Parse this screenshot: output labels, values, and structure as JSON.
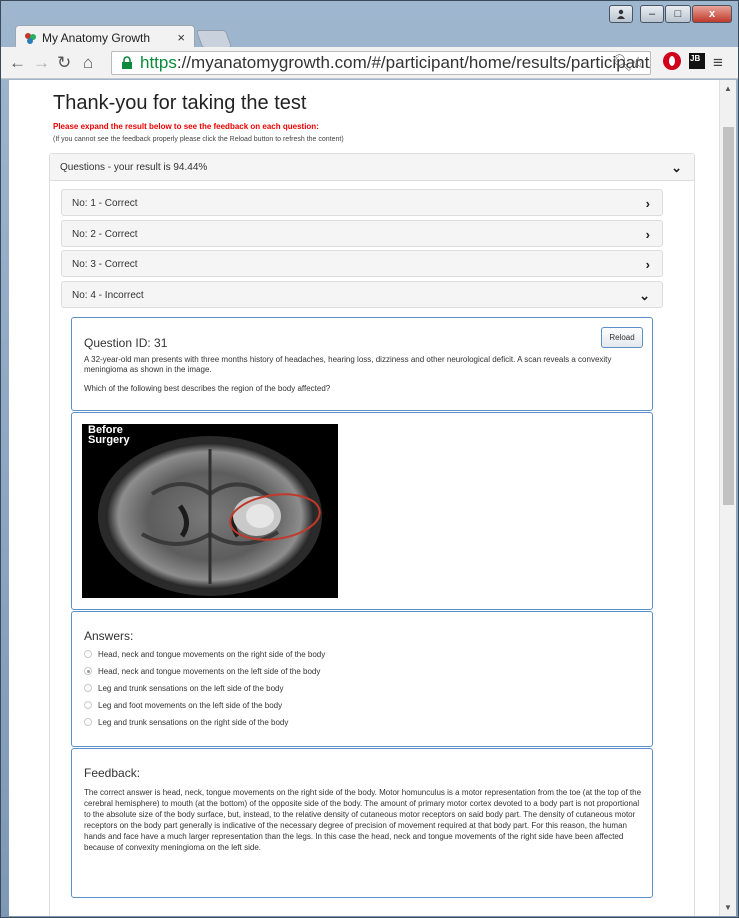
{
  "browser": {
    "tab_title": "My Anatomy Growth",
    "tab_close": "×",
    "url_scheme": "https",
    "url_rest": "://myanatomygrowth.com/#/participant/home/results/participantAs",
    "window_controls": [
      "–",
      "□",
      "x"
    ],
    "jb_label": "JB"
  },
  "page": {
    "heading": "Thank-you for taking the test",
    "warning": "Please expand the result below to see the feedback on each question:",
    "hint": "(If you cannot see the feedback properly please click the Reload button to refresh the content)"
  },
  "result": {
    "summary": "Questions - your result is 94.44%",
    "items": [
      {
        "label": "No: 1 - Correct"
      },
      {
        "label": "No: 2 - Correct"
      },
      {
        "label": "No: 3 - Correct"
      },
      {
        "label": "No: 4 - Incorrect"
      }
    ]
  },
  "question": {
    "id_label": "Question ID: 31",
    "reload_label": "Reload",
    "stem": "A 32-year-old man presents with three months history of headaches, hearing loss, dizziness and other neurological deficit. A scan reveals a convexity meningioma as shown in the image.",
    "prompt": "Which of the following best describes the region of the body affected?",
    "image_caption": "Before\nSurgery"
  },
  "answers": {
    "title": "Answers:",
    "options": [
      {
        "text": "Head, neck and tongue movements on the right side of the body",
        "selected": false
      },
      {
        "text": "Head, neck and tongue movements on the left side of the body",
        "selected": true
      },
      {
        "text": "Leg and trunk sensations on the left side of the body",
        "selected": false
      },
      {
        "text": "Leg and foot movements on the left side of the body",
        "selected": false
      },
      {
        "text": "Leg and trunk sensations on the right side of the body",
        "selected": false
      }
    ]
  },
  "feedback": {
    "title": "Feedback:",
    "text": "The correct answer is head, neck, tongue movements on the right side of the body. Motor homunculus is a motor representation from the toe (at the top of the cerebral hemisphere) to mouth (at the bottom) of the opposite side of the body. The amount of primary motor cortex devoted to a body part is not proportional to the absolute size of the body surface, but, instead, to the relative density of cutaneous motor receptors on said body part. The density of cutaneous motor receptors on the body part generally is indicative of the necessary degree of precision of movement required at that body part. For this reason, the human hands and face have a much larger representation than the legs. In this case the head, neck and tongue movements of the right side have been affected because of convexity meningioma on the left side."
  },
  "colors": {
    "accent_border": "#5a8fc7",
    "warning": "#ee0000",
    "secure_url": "#0a8a3a"
  }
}
